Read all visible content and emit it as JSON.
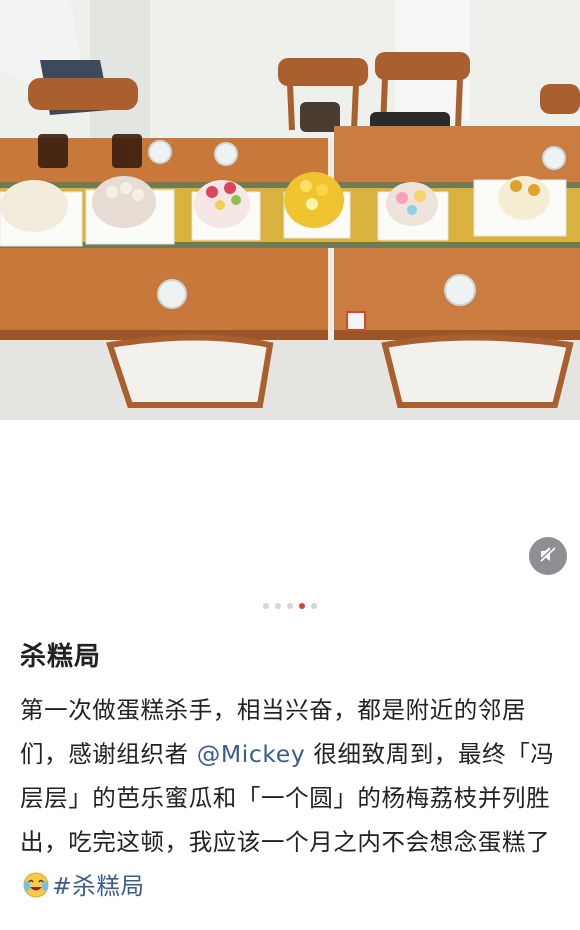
{
  "post": {
    "title": "杀糕局",
    "body_before_mention": "第一次做蛋糕杀手，相当兴奋，都是附近的邻居们，感谢组织者 ",
    "mention": "@Mickey",
    "body_after_mention": " 很细致周到，最终「冯层层」的芭乐蜜瓜和「一个圆」的杨梅荔枝并列胜出，吃完这顿，我应该一个月之内不会想念蛋糕了",
    "emoji": "crying-laughing-emoji",
    "hashtag": "#杀糕局"
  },
  "carousel": {
    "total": 5,
    "active_index": 3
  },
  "icons": {
    "mute": "speaker-muted-icon"
  },
  "colors": {
    "link": "#3b5b8e",
    "active_dot": "#e0403a",
    "table": "#c9783c"
  }
}
